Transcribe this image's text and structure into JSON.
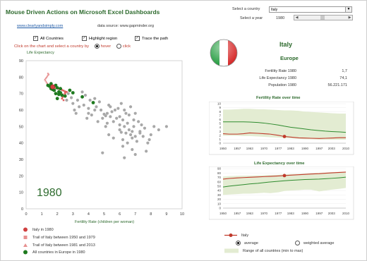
{
  "header": {
    "title": "Mouse Driven Actions on Microsoft Excel Dashboards",
    "link": "www.clearlyandsimply.com",
    "source": "data source: www.gapminder.org"
  },
  "controls": {
    "country_label": "Select a country",
    "country_value": "Italy",
    "year_label": "Select a year",
    "year_value": "1980",
    "year_fraction": 0.48,
    "all_countries": "All Countries",
    "highlight_region": "Highlight region",
    "trace_path": "Trace the path",
    "instruction": "Click on the chart and select a country by",
    "hover": "hover",
    "click": "click"
  },
  "scatter": {
    "ylabel": "Life Expectancy",
    "xlabel": "Fertility Rate (children per woman)",
    "year_watermark": "1980",
    "colors": {
      "selected": "#d04040",
      "trail_before": "#e06060",
      "trail_after": "#e79090",
      "europe": "#1f7a1f",
      "other": "#a8a8a8"
    }
  },
  "legend": {
    "items": [
      {
        "label": "Italy in 1980",
        "marker": "circle-red"
      },
      {
        "label": "Trail of Italy between 1950 and 1979",
        "marker": "square-pink"
      },
      {
        "label": "Trail of Italy between 1981 and 2013",
        "marker": "triangle-pink"
      },
      {
        "label": "All countries in Europe in 1980",
        "marker": "circle-green"
      }
    ]
  },
  "detail": {
    "country": "Italy",
    "region": "Europe",
    "stats": [
      {
        "label": "Fertility Rate 1980",
        "value": "1,7"
      },
      {
        "label": "Life Expectancy 1980",
        "value": "74,1"
      },
      {
        "label": "Population 1980",
        "value": "56.221.171"
      }
    ]
  },
  "small_charts": {
    "fertility_title": "Fertility Rate over time",
    "life_title": "Life Expectancy over time"
  },
  "bottom_legend": {
    "italy": "Italy",
    "average": "average",
    "weighted": "weighted average",
    "range": "Range of all countries (min to max)"
  },
  "chart_data": [
    {
      "type": "scatter",
      "title": "",
      "xlabel": "Fertility Rate (children per woman)",
      "ylabel": "Life Expectancy",
      "xlim": [
        0,
        10
      ],
      "ylim": [
        0,
        90
      ],
      "grid": false,
      "series": [
        {
          "name": "Italy in 1980",
          "points": [
            [
              1.7,
              74.1
            ]
          ]
        },
        {
          "name": "Trail of Italy between 1950 and 1979",
          "points": [
            [
              2.4,
              66
            ],
            [
              2.3,
              67
            ],
            [
              2.35,
              68
            ],
            [
              2.3,
              69
            ],
            [
              2.35,
              69.5
            ],
            [
              2.5,
              70
            ],
            [
              2.5,
              70.5
            ],
            [
              2.6,
              71
            ],
            [
              2.5,
              71.3
            ],
            [
              2.4,
              71.8
            ],
            [
              2.3,
              72.2
            ],
            [
              2.1,
              72.8
            ],
            [
              1.9,
              73.3
            ],
            [
              1.8,
              73.7
            ]
          ]
        },
        {
          "name": "Trail of Italy between 1981 and 2013",
          "points": [
            [
              1.6,
              74.5
            ],
            [
              1.5,
              75
            ],
            [
              1.4,
              75.6
            ],
            [
              1.35,
              76.3
            ],
            [
              1.3,
              77
            ],
            [
              1.25,
              77.8
            ],
            [
              1.2,
              78.5
            ],
            [
              1.25,
              79.2
            ],
            [
              1.3,
              79.8
            ],
            [
              1.35,
              80.5
            ],
            [
              1.4,
              81.2
            ],
            [
              1.45,
              81.8
            ],
            [
              1.4,
              82.3
            ]
          ]
        },
        {
          "name": "All countries in Europe in 1980",
          "points": [
            [
              1.6,
              73
            ],
            [
              1.8,
              72
            ],
            [
              1.9,
              75
            ],
            [
              2.0,
              73.5
            ],
            [
              1.7,
              72.5
            ],
            [
              2.1,
              71
            ],
            [
              2.2,
              70.5
            ],
            [
              1.5,
              74.5
            ],
            [
              2.3,
              69
            ],
            [
              1.9,
              70
            ],
            [
              2.5,
              68.5
            ],
            [
              3.0,
              70.5
            ],
            [
              3.6,
              68
            ],
            [
              2.0,
              67
            ],
            [
              1.4,
              75
            ],
            [
              1.6,
              76
            ],
            [
              2.2,
              73
            ],
            [
              4.3,
              64.5
            ],
            [
              2.8,
              72
            ],
            [
              2.1,
              69.5
            ]
          ]
        },
        {
          "name": "other countries",
          "points": [
            [
              3.0,
              64
            ],
            [
              3.4,
              62
            ],
            [
              3.1,
              60
            ],
            [
              2.9,
              67.5
            ],
            [
              2.6,
              66
            ],
            [
              3.6,
              71
            ],
            [
              4.1,
              66
            ],
            [
              4.0,
              61
            ],
            [
              4.5,
              62
            ],
            [
              4.8,
              60
            ],
            [
              4.9,
              55
            ],
            [
              5.2,
              58
            ],
            [
              5.0,
              57.5
            ],
            [
              5.5,
              59
            ],
            [
              5.4,
              56
            ],
            [
              5.1,
              56.5
            ],
            [
              5.8,
              55
            ],
            [
              5.6,
              53
            ],
            [
              6.0,
              56
            ],
            [
              6.2,
              54
            ],
            [
              6.0,
              51
            ],
            [
              6.3,
              50
            ],
            [
              6.5,
              52
            ],
            [
              6.6,
              48
            ],
            [
              6.4,
              46
            ],
            [
              6.8,
              47
            ],
            [
              6.7,
              45
            ],
            [
              7.0,
              44
            ],
            [
              6.1,
              46.5
            ],
            [
              6.9,
              50
            ],
            [
              7.1,
              41
            ],
            [
              6.2,
              42
            ],
            [
              6.5,
              40
            ],
            [
              6.8,
              43
            ],
            [
              7.3,
              46
            ],
            [
              7.6,
              49
            ],
            [
              7.3,
              47
            ],
            [
              8.0,
              45
            ],
            [
              8.2,
              50
            ],
            [
              8.5,
              48
            ],
            [
              9.0,
              50
            ],
            [
              5.7,
              60
            ],
            [
              5.3,
              63
            ],
            [
              4.7,
              65
            ],
            [
              4.4,
              67
            ],
            [
              3.8,
              69
            ],
            [
              3.3,
              66
            ],
            [
              5.4,
              62
            ],
            [
              6.3,
              60
            ],
            [
              6.6,
              57
            ],
            [
              6.9,
              54
            ],
            [
              7.2,
              53
            ],
            [
              7.4,
              51
            ],
            [
              6.4,
              58
            ],
            [
              5.9,
              61
            ],
            [
              5.2,
              52
            ],
            [
              4.6,
              53
            ],
            [
              4.0,
              58
            ],
            [
              3.7,
              63
            ],
            [
              6.0,
              48
            ],
            [
              5.3,
              45
            ],
            [
              5.6,
              43
            ],
            [
              6.2,
              38
            ],
            [
              6.8,
              36
            ],
            [
              7.7,
              35
            ],
            [
              7.0,
              33
            ],
            [
              4.9,
              34
            ],
            [
              6.3,
              31
            ],
            [
              7.9,
              42
            ],
            [
              7.5,
              44
            ],
            [
              7.8,
              40
            ],
            [
              4.4,
              60
            ],
            [
              3.9,
              55
            ],
            [
              4.2,
              57
            ],
            [
              5.1,
              50
            ],
            [
              6.7,
              62
            ],
            [
              7.0,
              58
            ],
            [
              6.1,
              64
            ],
            [
              3.2,
              58
            ],
            [
              2.7,
              70
            ]
          ]
        }
      ]
    },
    {
      "type": "area",
      "title": "Fertility Rate over time",
      "x": [
        1950,
        1953,
        1957,
        1960,
        1963,
        1967,
        1970,
        1973,
        1977,
        1980,
        1983,
        1987,
        1990,
        1993,
        1997,
        2000,
        2003,
        2007,
        2010
      ],
      "xlim": [
        1950,
        2010
      ],
      "ylim": [
        0,
        10
      ],
      "series": [
        {
          "name": "Italy",
          "values": [
            2.4,
            2.3,
            2.3,
            2.4,
            2.6,
            2.5,
            2.4,
            2.3,
            2.0,
            1.7,
            1.55,
            1.35,
            1.3,
            1.25,
            1.2,
            1.25,
            1.3,
            1.4,
            1.4
          ]
        },
        {
          "name": "average",
          "values": [
            5.4,
            5.4,
            5.4,
            5.4,
            5.35,
            5.25,
            5.1,
            4.9,
            4.6,
            4.3,
            4.05,
            3.8,
            3.6,
            3.4,
            3.2,
            3.05,
            2.95,
            2.85,
            2.75
          ]
        },
        {
          "name": "weighted average",
          "values": [
            4.9,
            4.95,
            5.0,
            5.0,
            4.95,
            4.8,
            4.5,
            4.1,
            3.8,
            3.6,
            3.45,
            3.3,
            3.1,
            2.9,
            2.75,
            2.65,
            2.6,
            2.55,
            2.5
          ]
        },
        {
          "name": "Range of all countries (min to max)",
          "min": [
            1.9,
            1.9,
            1.9,
            1.8,
            1.8,
            1.7,
            1.6,
            1.5,
            1.4,
            1.3,
            1.2,
            1.1,
            1.0,
            1.0,
            0.9,
            0.9,
            0.9,
            0.9,
            0.9
          ],
          "max": [
            8.5,
            8.5,
            8.6,
            8.7,
            8.7,
            8.6,
            8.6,
            8.5,
            8.4,
            8.3,
            8.3,
            8.2,
            8.0,
            7.9,
            7.8,
            7.7,
            7.6,
            7.5,
            7.5
          ]
        }
      ]
    },
    {
      "type": "area",
      "title": "Life Expectancy over time",
      "x": [
        1950,
        1953,
        1957,
        1960,
        1963,
        1967,
        1970,
        1973,
        1977,
        1980,
        1983,
        1987,
        1990,
        1993,
        1997,
        2000,
        2003,
        2007,
        2010
      ],
      "xlim": [
        1950,
        2010
      ],
      "ylim": [
        0,
        90
      ],
      "series": [
        {
          "name": "Italy",
          "values": [
            66,
            67.5,
            68.8,
            69.5,
            70.2,
            71,
            71.7,
            72.3,
            73.2,
            74.1,
            75,
            76,
            76.8,
            77.6,
            78.5,
            79.5,
            80.3,
            81.2,
            82
          ]
        },
        {
          "name": "average",
          "values": [
            48,
            50,
            52,
            53.5,
            55,
            56.5,
            58,
            59.5,
            61,
            62.3,
            63.3,
            64.3,
            65,
            65.5,
            66,
            66.8,
            67.8,
            69.2,
            70.5
          ]
        },
        {
          "name": "weighted average",
          "values": [
            47,
            49,
            51,
            53,
            54.5,
            56,
            57.5,
            59,
            60.5,
            62,
            63,
            64,
            64.8,
            65.5,
            66.2,
            67,
            68,
            69.3,
            70.3
          ]
        },
        {
          "name": "Range of all countries (min to max)",
          "min": [
            30,
            31,
            32,
            33,
            33,
            34,
            35,
            34,
            36,
            39,
            40,
            41,
            42,
            42,
            38,
            40,
            42,
            44,
            46
          ],
          "max": [
            72,
            73,
            73.5,
            74,
            74,
            74.5,
            75,
            75.5,
            76,
            77,
            77.5,
            78,
            78.8,
            79.5,
            80.3,
            81,
            82,
            82.6,
            83
          ]
        }
      ]
    }
  ]
}
